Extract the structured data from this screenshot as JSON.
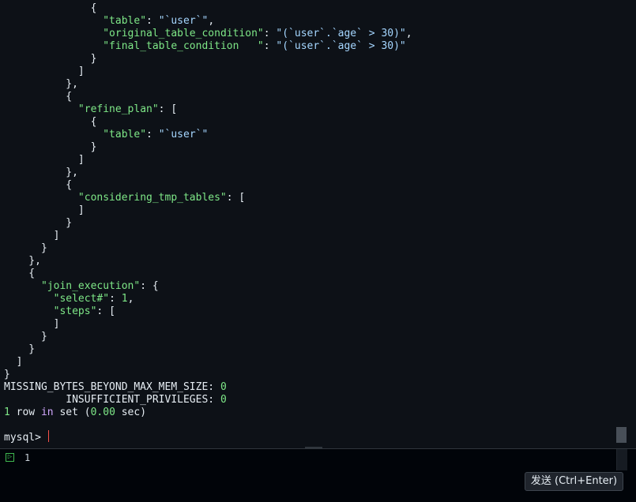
{
  "terminal": {
    "lines": [
      [
        {
          "c": "p",
          "t": "              {"
        }
      ],
      [
        {
          "c": "p",
          "t": "                "
        },
        {
          "c": "k",
          "t": "\"table\""
        },
        {
          "c": "p",
          "t": ": "
        },
        {
          "c": "s",
          "t": "\"`user`\""
        },
        {
          "c": "p",
          "t": ","
        }
      ],
      [
        {
          "c": "p",
          "t": "                "
        },
        {
          "c": "k",
          "t": "\"original_table_condition\""
        },
        {
          "c": "p",
          "t": ": "
        },
        {
          "c": "s",
          "t": "\"(`user`.`age` > 30)\""
        },
        {
          "c": "p",
          "t": ","
        }
      ],
      [
        {
          "c": "p",
          "t": "                "
        },
        {
          "c": "k",
          "t": "\"final_table_condition   \""
        },
        {
          "c": "p",
          "t": ": "
        },
        {
          "c": "s",
          "t": "\"(`user`.`age` > 30)\""
        }
      ],
      [
        {
          "c": "p",
          "t": "              }"
        }
      ],
      [
        {
          "c": "p",
          "t": "            ]"
        }
      ],
      [
        {
          "c": "p",
          "t": "          },"
        }
      ],
      [
        {
          "c": "p",
          "t": "          {"
        }
      ],
      [
        {
          "c": "p",
          "t": "            "
        },
        {
          "c": "k",
          "t": "\"refine_plan\""
        },
        {
          "c": "p",
          "t": ": ["
        }
      ],
      [
        {
          "c": "p",
          "t": "              {"
        }
      ],
      [
        {
          "c": "p",
          "t": "                "
        },
        {
          "c": "k",
          "t": "\"table\""
        },
        {
          "c": "p",
          "t": ": "
        },
        {
          "c": "s",
          "t": "\"`user`\""
        }
      ],
      [
        {
          "c": "p",
          "t": "              }"
        }
      ],
      [
        {
          "c": "p",
          "t": "            ]"
        }
      ],
      [
        {
          "c": "p",
          "t": "          },"
        }
      ],
      [
        {
          "c": "p",
          "t": "          {"
        }
      ],
      [
        {
          "c": "p",
          "t": "            "
        },
        {
          "c": "k",
          "t": "\"considering_tmp_tables\""
        },
        {
          "c": "p",
          "t": ": ["
        }
      ],
      [
        {
          "c": "p",
          "t": "            ]"
        }
      ],
      [
        {
          "c": "p",
          "t": "          }"
        }
      ],
      [
        {
          "c": "p",
          "t": "        ]"
        }
      ],
      [
        {
          "c": "p",
          "t": "      }"
        }
      ],
      [
        {
          "c": "p",
          "t": "    },"
        }
      ],
      [
        {
          "c": "p",
          "t": "    {"
        }
      ],
      [
        {
          "c": "p",
          "t": "      "
        },
        {
          "c": "k",
          "t": "\"join_execution\""
        },
        {
          "c": "p",
          "t": ": {"
        }
      ],
      [
        {
          "c": "p",
          "t": "        "
        },
        {
          "c": "k",
          "t": "\"select#\""
        },
        {
          "c": "p",
          "t": ": "
        },
        {
          "c": "n",
          "t": "1"
        },
        {
          "c": "p",
          "t": ","
        }
      ],
      [
        {
          "c": "p",
          "t": "        "
        },
        {
          "c": "k",
          "t": "\"steps\""
        },
        {
          "c": "p",
          "t": ": ["
        }
      ],
      [
        {
          "c": "p",
          "t": "        ]"
        }
      ],
      [
        {
          "c": "p",
          "t": "      }"
        }
      ],
      [
        {
          "c": "p",
          "t": "    }"
        }
      ],
      [
        {
          "c": "p",
          "t": "  ]"
        }
      ],
      [
        {
          "c": "p",
          "t": "}"
        }
      ],
      [
        {
          "c": "w",
          "t": "MISSING_BYTES_BEYOND_MAX_MEM_SIZE: "
        },
        {
          "c": "n",
          "t": "0"
        }
      ],
      [
        {
          "c": "w",
          "t": "          INSUFFICIENT_PRIVILEGES: "
        },
        {
          "c": "n",
          "t": "0"
        }
      ],
      [
        {
          "c": "n",
          "t": "1"
        },
        {
          "c": "w",
          "t": " row "
        },
        {
          "c": "kw",
          "t": "in"
        },
        {
          "c": "w",
          "t": " set ("
        },
        {
          "c": "n",
          "t": "0.00"
        },
        {
          "c": "w",
          "t": " sec)"
        }
      ],
      [
        {
          "c": "w",
          "t": ""
        }
      ],
      [
        {
          "c": "prompt",
          "t": "mysql> "
        }
      ]
    ]
  },
  "input": {
    "text": "1",
    "icon": "run-icon"
  },
  "send_button": {
    "label": "发送 (Ctrl+Enter)"
  },
  "colors": {
    "background": "#0d1117",
    "key": "#7ee787",
    "string": "#a5d6ff",
    "cursor": "#f85149"
  }
}
